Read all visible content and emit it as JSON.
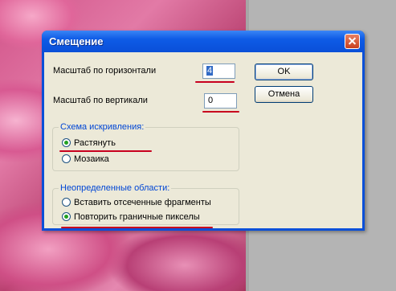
{
  "dialog": {
    "title": "Смещение",
    "horizontal_label": "Масштаб по горизонтали",
    "horizontal_value": "4",
    "vertical_label": "Масштаб по вертикали",
    "vertical_value": "0",
    "ok_label": "OK",
    "cancel_label": "Отмена",
    "distortion_group": {
      "legend": "Схема искривления:",
      "options": [
        "Растянуть",
        "Мозаика"
      ],
      "selected": "Растянуть"
    },
    "undefined_group": {
      "legend": "Неопределенные области:",
      "options": [
        "Вставить отсеченные фрагменты",
        "Повторить граничные пикселы"
      ],
      "selected": "Повторить граничные пикселы"
    }
  },
  "colors": {
    "title_bar": "#0a4fd8",
    "dialog_bg": "#ece9d8",
    "group_legend": "#0046d5",
    "annotation_underline": "#c8001e"
  }
}
